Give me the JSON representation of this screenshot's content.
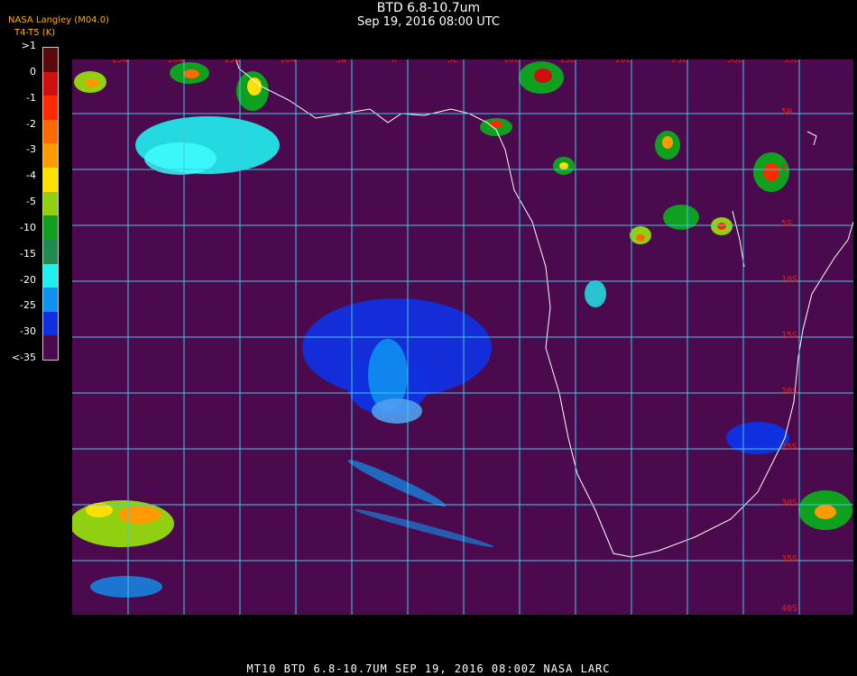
{
  "header": {
    "title": "BTD 6.8-10.7um",
    "subtitle": "Sep 19, 2016 08:00 UTC",
    "credit_line1": "NASA Langley (M04.0)",
    "credit_line2": "T4-T5 (K)"
  },
  "colorbar": {
    "labels": [
      ">1",
      "0",
      "-1",
      "-2",
      "-3",
      "-4",
      "-5",
      "-10",
      "-15",
      "-20",
      "-25",
      "-30",
      "<-35"
    ],
    "colors": [
      "#5a0a0a",
      "#d01010",
      "#ff2a00",
      "#ff6a00",
      "#ff9a00",
      "#ffe000",
      "#90d010",
      "#10a020",
      "#208a50",
      "#20f0f0",
      "#1090f0",
      "#1030e0",
      "#4b0a4d"
    ]
  },
  "map": {
    "background": "#4b0a4d",
    "grid_color": "#40c8e8",
    "label_color": "#dd2020",
    "lon_labels": [
      "25W",
      "20W",
      "15W",
      "10W",
      "5W",
      "0",
      "5E",
      "10E",
      "15E",
      "20E",
      "25E",
      "30E",
      "35E"
    ],
    "lat_labels": [
      "5N",
      "0",
      "5S",
      "10S",
      "15S",
      "20S",
      "25S",
      "30S",
      "35S",
      "40S"
    ]
  },
  "footer": {
    "text": "MT10   BTD 6.8-10.7UM    SEP 19, 2016 08:00Z    NASA LARC"
  }
}
